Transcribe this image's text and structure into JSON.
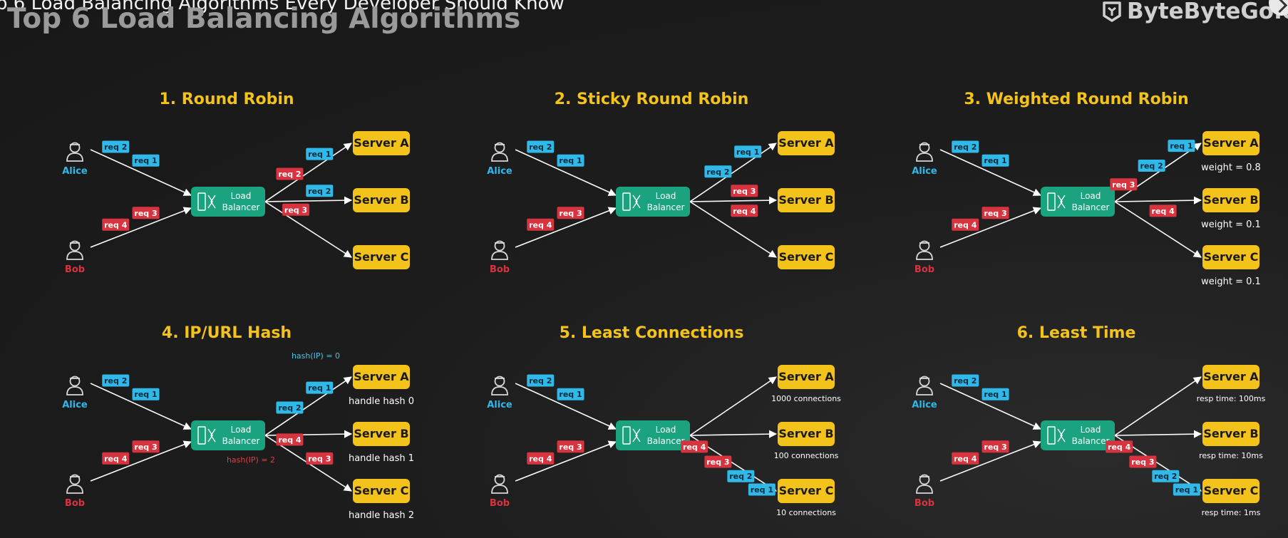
{
  "video_title": "p 6 Load Balancing Algorithms Every Developer Should Know",
  "header": {
    "title": "Top 6 Load Balancing Algorithms",
    "logo_text": "ByteByteGo.c"
  },
  "colors": {
    "blue": "#2fb8e8",
    "red": "#d8343f",
    "teal": "#1aa37e",
    "yellow": "#f3c21b",
    "title": "#f3c21b"
  },
  "labels": {
    "load_balancer_line1": "Load",
    "load_balancer_line2": "Balancer"
  },
  "sections": [
    {
      "title": "1. Round Robin",
      "users": [
        "Alice",
        "Bob"
      ],
      "servers": [
        {
          "name": "Server A",
          "note": ""
        },
        {
          "name": "Server B",
          "note": ""
        },
        {
          "name": "Server C",
          "note": ""
        }
      ],
      "input_reqs": [
        {
          "label": "req 2",
          "color": "blue",
          "t": 0.25,
          "pos": "alice-far"
        },
        {
          "label": "req 1",
          "color": "blue",
          "t": 0.55,
          "pos": "alice-near"
        },
        {
          "label": "req 4",
          "color": "red",
          "t": 0.25,
          "pos": "bob-far"
        },
        {
          "label": "req 3",
          "color": "red",
          "t": 0.55,
          "pos": "bob-near"
        }
      ],
      "output_reqs": [
        {
          "label": "req 2",
          "color": "red",
          "server": 0,
          "t": 0.28
        },
        {
          "label": "req 1",
          "color": "blue",
          "server": 0,
          "t": 0.62
        },
        {
          "label": "req 2",
          "color": "blue",
          "server": 1,
          "t": 0.62
        },
        {
          "label": "req 3",
          "color": "red",
          "server": 2,
          "t": 0.35
        }
      ],
      "annotations": []
    },
    {
      "title": "2. Sticky Round Robin",
      "users": [
        "Alice",
        "Bob"
      ],
      "servers": [
        {
          "name": "Server A",
          "note": ""
        },
        {
          "name": "Server B",
          "note": ""
        },
        {
          "name": "Server C",
          "note": ""
        }
      ],
      "input_reqs": [
        {
          "label": "req 2",
          "color": "blue",
          "t": 0.25,
          "pos": "alice-far"
        },
        {
          "label": "req 1",
          "color": "blue",
          "t": 0.55,
          "pos": "alice-near"
        },
        {
          "label": "req 4",
          "color": "red",
          "t": 0.25,
          "pos": "bob-far"
        },
        {
          "label": "req 3",
          "color": "red",
          "t": 0.55,
          "pos": "bob-near"
        }
      ],
      "output_reqs": [
        {
          "label": "req 2",
          "color": "blue",
          "server": 0,
          "t": 0.32
        },
        {
          "label": "req 1",
          "color": "blue",
          "server": 0,
          "t": 0.66
        },
        {
          "label": "req 3",
          "color": "red",
          "server": 1,
          "t": 0.62,
          "above": true
        },
        {
          "label": "req 4",
          "color": "red",
          "server": 1,
          "t": 0.62,
          "below": true
        }
      ],
      "annotations": []
    },
    {
      "title": "3. Weighted Round Robin",
      "users": [
        "Alice",
        "Bob"
      ],
      "servers": [
        {
          "name": "Server A",
          "note": "weight = 0.8"
        },
        {
          "name": "Server B",
          "note": "weight = 0.1"
        },
        {
          "name": "Server C",
          "note": "weight = 0.1"
        }
      ],
      "input_reqs": [
        {
          "label": "req 2",
          "color": "blue",
          "t": 0.25,
          "pos": "alice-far"
        },
        {
          "label": "req 1",
          "color": "blue",
          "t": 0.55,
          "pos": "alice-near"
        },
        {
          "label": "req 4",
          "color": "red",
          "t": 0.25,
          "pos": "bob-far"
        },
        {
          "label": "req 3",
          "color": "red",
          "t": 0.55,
          "pos": "bob-near"
        }
      ],
      "output_reqs": [
        {
          "label": "req 3",
          "color": "red",
          "server": 0,
          "t": 0.1
        },
        {
          "label": "req 2",
          "color": "blue",
          "server": 0,
          "t": 0.42
        },
        {
          "label": "req 1",
          "color": "blue",
          "server": 0,
          "t": 0.76
        },
        {
          "label": "req 4",
          "color": "red",
          "server": 1,
          "t": 0.55,
          "below": true
        }
      ],
      "annotations": []
    },
    {
      "title": "4. IP/URL Hash",
      "users": [
        "Alice",
        "Bob"
      ],
      "servers": [
        {
          "name": "Server A",
          "note": "handle hash 0"
        },
        {
          "name": "Server B",
          "note": "handle hash 1"
        },
        {
          "name": "Server C",
          "note": "handle hash 2"
        }
      ],
      "input_reqs": [
        {
          "label": "req 2",
          "color": "blue",
          "t": 0.25,
          "pos": "alice-far"
        },
        {
          "label": "req 1",
          "color": "blue",
          "t": 0.55,
          "pos": "alice-near"
        },
        {
          "label": "req 4",
          "color": "red",
          "t": 0.25,
          "pos": "bob-far"
        },
        {
          "label": "req 3",
          "color": "red",
          "t": 0.55,
          "pos": "bob-near"
        }
      ],
      "output_reqs": [
        {
          "label": "req 2",
          "color": "blue",
          "server": 0,
          "t": 0.28
        },
        {
          "label": "req 1",
          "color": "blue",
          "server": 0,
          "t": 0.62
        },
        {
          "label": "req 4",
          "color": "red",
          "server": 2,
          "t": 0.28
        },
        {
          "label": "req 3",
          "color": "red",
          "server": 2,
          "t": 0.62
        }
      ],
      "annotations": [
        {
          "text": "hash(IP) = 0",
          "color": "blue",
          "anchor": "serverA-top"
        },
        {
          "text": "hash(IP) = 2",
          "color": "red",
          "anchor": "lb-bottom"
        }
      ]
    },
    {
      "title": "5. Least Connections",
      "users": [
        "Alice",
        "Bob"
      ],
      "servers": [
        {
          "name": "Server A",
          "note": "1000 connections"
        },
        {
          "name": "Server B",
          "note": "100 connections"
        },
        {
          "name": "Server C",
          "note": "10 connections"
        }
      ],
      "input_reqs": [
        {
          "label": "req 2",
          "color": "blue",
          "t": 0.25,
          "pos": "alice-far"
        },
        {
          "label": "req 1",
          "color": "blue",
          "t": 0.55,
          "pos": "alice-near"
        },
        {
          "label": "req 4",
          "color": "red",
          "t": 0.25,
          "pos": "bob-far"
        },
        {
          "label": "req 3",
          "color": "red",
          "t": 0.55,
          "pos": "bob-near"
        }
      ],
      "output_reqs": [
        {
          "label": "req 4",
          "color": "red",
          "server": 2,
          "t": 0.05
        },
        {
          "label": "req 3",
          "color": "red",
          "server": 2,
          "t": 0.32
        },
        {
          "label": "req 2",
          "color": "blue",
          "server": 2,
          "t": 0.58
        },
        {
          "label": "req 1",
          "color": "blue",
          "server": 2,
          "t": 0.82
        }
      ],
      "annotations": []
    },
    {
      "title": "6. Least Time",
      "users": [
        "Alice",
        "Bob"
      ],
      "servers": [
        {
          "name": "Server A",
          "note": "resp time: 100ms"
        },
        {
          "name": "Server B",
          "note": "resp time: 10ms"
        },
        {
          "name": "Server C",
          "note": "resp time: 1ms"
        }
      ],
      "input_reqs": [
        {
          "label": "req 2",
          "color": "blue",
          "t": 0.25,
          "pos": "alice-far"
        },
        {
          "label": "req 1",
          "color": "blue",
          "t": 0.55,
          "pos": "alice-near"
        },
        {
          "label": "req 4",
          "color": "red",
          "t": 0.25,
          "pos": "bob-far"
        },
        {
          "label": "req 3",
          "color": "red",
          "t": 0.55,
          "pos": "bob-near"
        }
      ],
      "output_reqs": [
        {
          "label": "req 4",
          "color": "red",
          "server": 2,
          "t": 0.05
        },
        {
          "label": "req 3",
          "color": "red",
          "server": 2,
          "t": 0.32
        },
        {
          "label": "req 2",
          "color": "blue",
          "server": 2,
          "t": 0.58
        },
        {
          "label": "req 1",
          "color": "blue",
          "server": 2,
          "t": 0.82
        }
      ],
      "annotations": []
    }
  ]
}
